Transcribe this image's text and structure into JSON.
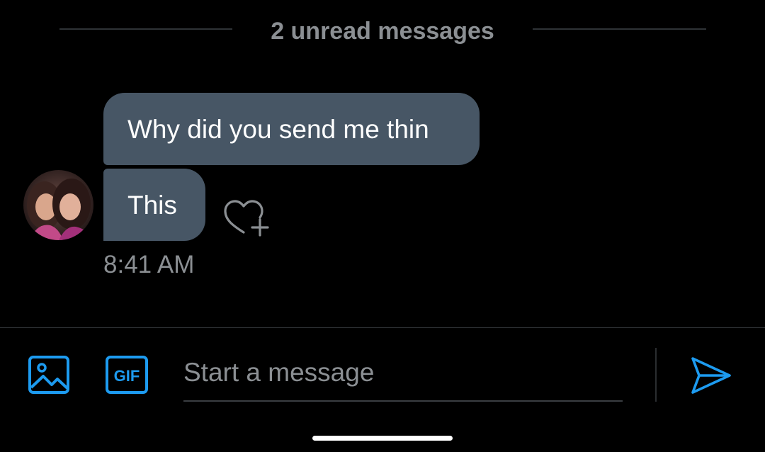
{
  "conversation": {
    "unread_label": "2 unread messages",
    "messages": [
      {
        "text": "Why did you send me thin"
      },
      {
        "text": "This"
      }
    ],
    "timestamp": "8:41 AM"
  },
  "composer": {
    "placeholder": "Start a message",
    "gif_label": "GIF",
    "media_icon": "image-icon",
    "send_icon": "send-icon"
  },
  "colors": {
    "background": "#000000",
    "bubble": "#475665",
    "accent": "#1d9bf0",
    "muted_text": "#8b8f93"
  }
}
